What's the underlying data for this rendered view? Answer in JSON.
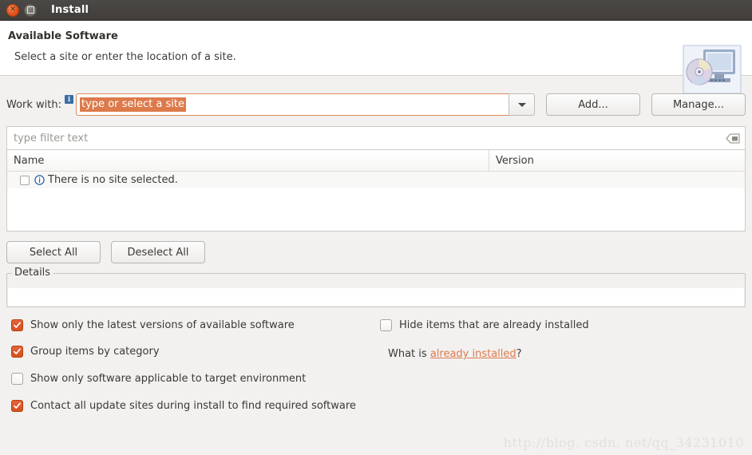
{
  "window": {
    "title": "Install",
    "close_icon": "close-icon",
    "maximize_icon": "maximize-icon"
  },
  "header": {
    "title": "Available Software",
    "subtitle": "Select a site or enter the location of a site.",
    "icon": "computer-disc-icon"
  },
  "work_with": {
    "label": "Work with:",
    "badge": "info-badge-icon",
    "input_value": "type or select a site",
    "dropdown_icon": "chevron-down-icon",
    "add_label": "Add...",
    "manage_label": "Manage..."
  },
  "filter": {
    "placeholder": "type filter text",
    "clear_icon": "clear-text-icon"
  },
  "table": {
    "columns": [
      "Name",
      "Version"
    ],
    "rows": [
      {
        "checked": false,
        "icon": "info-circle-icon",
        "name": "There is no site selected.",
        "version": ""
      }
    ]
  },
  "selection_buttons": {
    "select_all": "Select All",
    "deselect_all": "Deselect All"
  },
  "details": {
    "legend": "Details",
    "content": ""
  },
  "options": {
    "left": [
      {
        "label": "Show only the latest versions of available software",
        "checked": true
      },
      {
        "label": "Group items by category",
        "checked": true
      },
      {
        "label": "Show only software applicable to target environment",
        "checked": false
      },
      {
        "label": "Contact all update sites during install to find required software",
        "checked": true
      }
    ],
    "right": [
      {
        "label": "Hide items that are already installed",
        "checked": false
      }
    ],
    "what_is_prefix": "What is ",
    "what_is_link": "already installed",
    "what_is_suffix": "?"
  },
  "watermark": "http://blog. csdn. net/qq_34231010",
  "colors": {
    "accent": "#dd4814",
    "checkbox_on": "#d6511f",
    "link": "#dd7a4b",
    "titlebar": "#403d3a",
    "info_blue": "#3b6ea5"
  }
}
